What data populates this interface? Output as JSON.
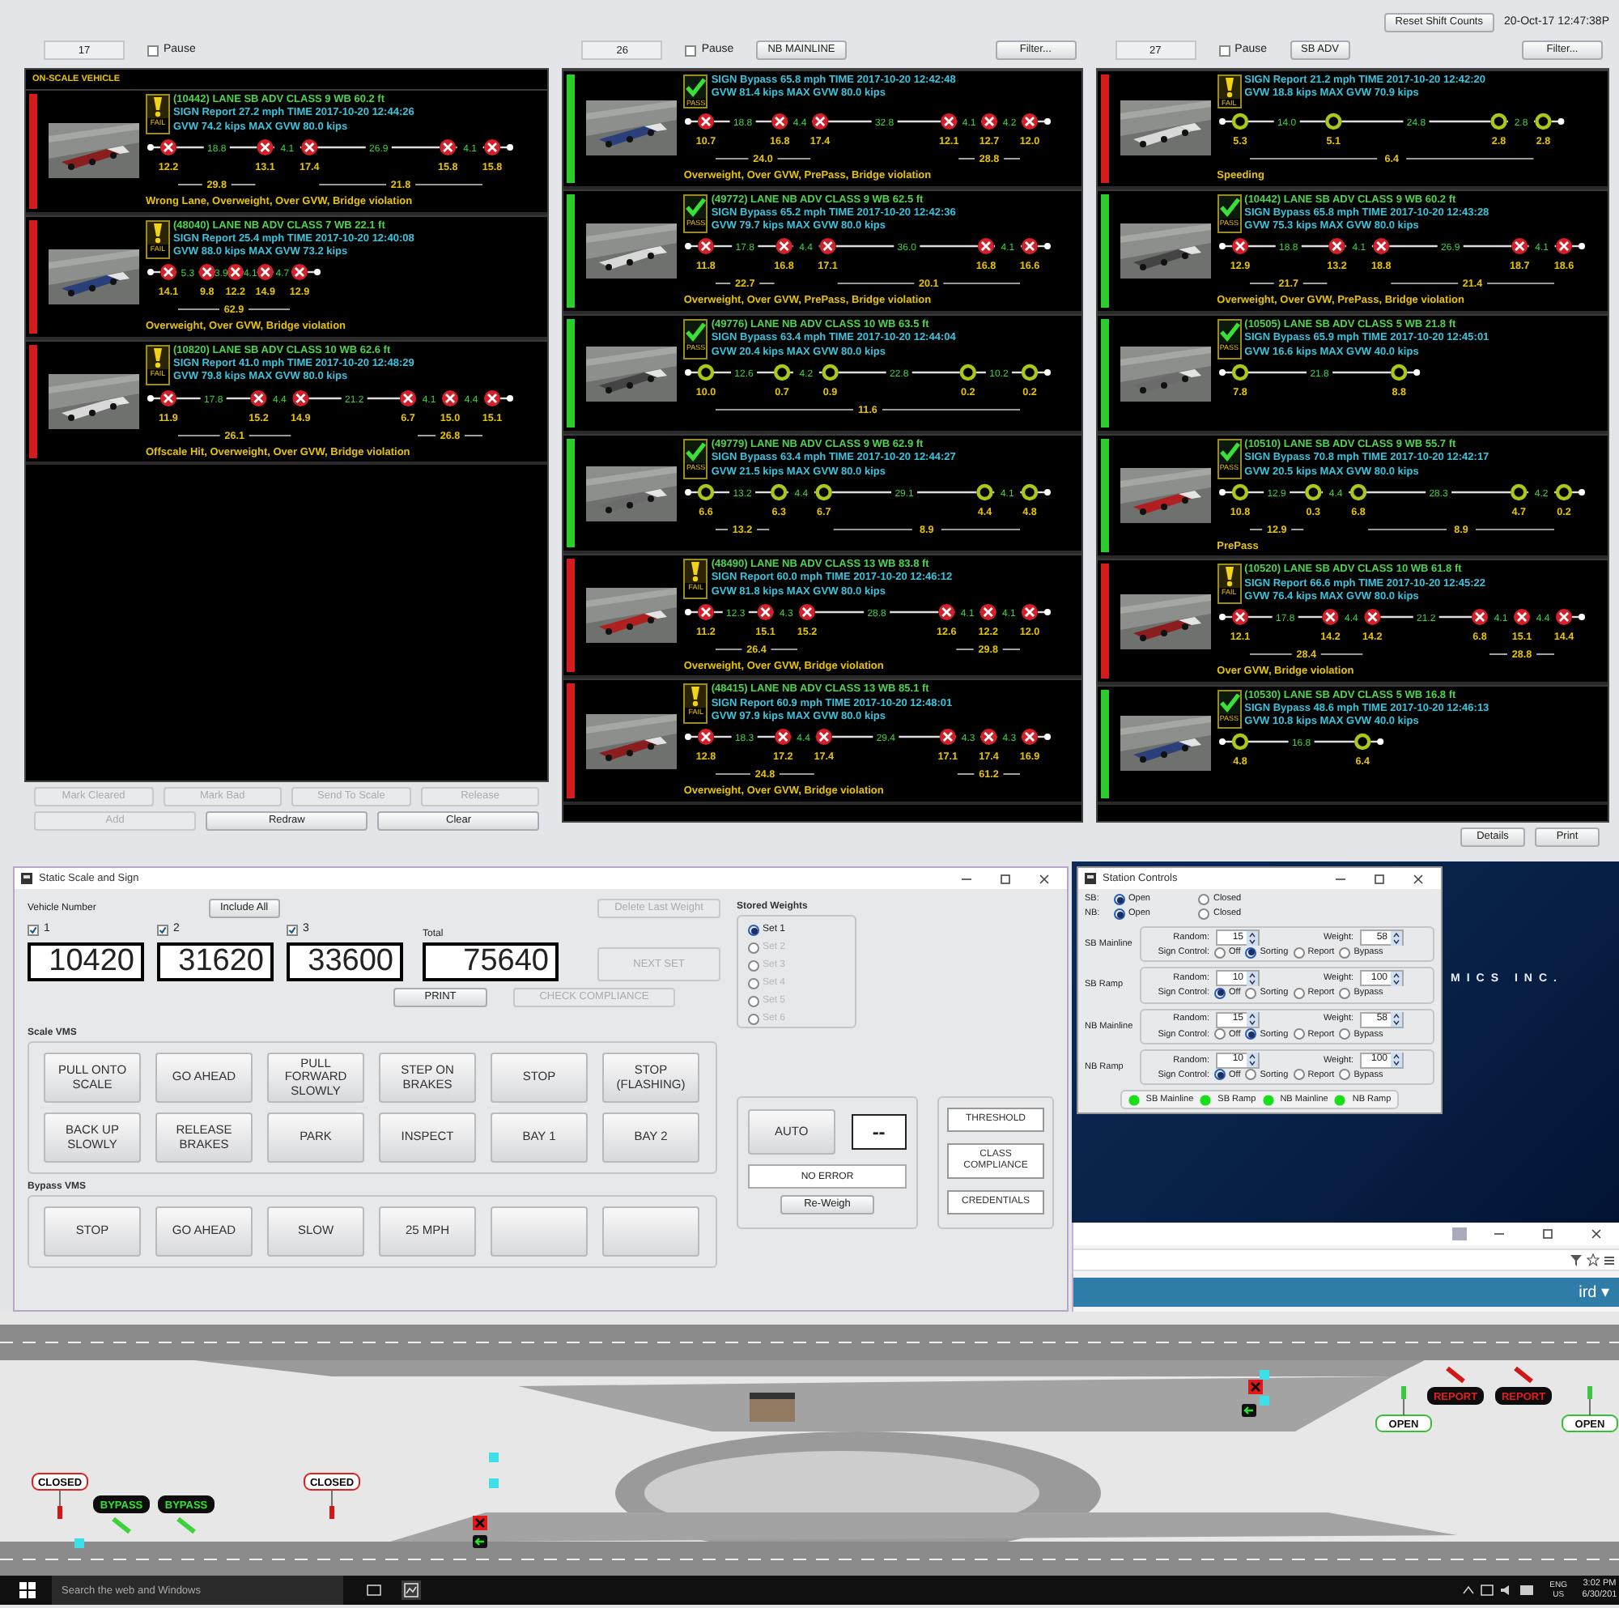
{
  "top_bar": {
    "reset_button": "Reset Shift Counts",
    "timestamp": "20-Oct-17 12:47:38P"
  },
  "panels": [
    {
      "count": "17",
      "pause": {
        "label": "Pause",
        "checked": false
      },
      "title": "ON-SCALE VEHICLE",
      "vehicles": [
        {
          "kind": "fail",
          "status_label": "FAIL",
          "lines": [
            "(10442) LANE SB ADV CLASS 9 WB 60.2 ft",
            "SIGN Report 27.2 mph TIME 2017-10-20 12:44:26",
            "GVW 74.2 kips MAX GVW 80.0 kips"
          ],
          "overweight_axles": true,
          "spacings": [
            "18.8",
            "4.1",
            "26.9",
            "4.1"
          ],
          "weights": [
            "12.2",
            "13.1",
            "17.4",
            "15.8",
            "15.8"
          ],
          "spans": [
            "29.8",
            "21.8"
          ],
          "violations": "Wrong Lane, Overweight, Over GVW, Bridge violation"
        },
        {
          "kind": "fail",
          "status_label": "FAIL",
          "lines": [
            "(48040) LANE NB ADV CLASS 7 WB 22.1 ft",
            "SIGN Report 25.4 mph TIME 2017-10-20 12:40:08",
            "GVW 88.0 kips MAX GVW 73.2 kips"
          ],
          "overweight_axles": true,
          "spacings": [
            "5.3",
            "3.9",
            "4.1",
            "4.7"
          ],
          "weights": [
            "14.1",
            "9.8",
            "12.2",
            "14.9",
            "12.9"
          ],
          "spans": [
            "62.9"
          ],
          "violations": "Overweight, Over GVW, Bridge violation"
        },
        {
          "kind": "fail",
          "status_label": "FAIL",
          "lines": [
            "(10820) LANE SB ADV CLASS 10 WB 62.6 ft",
            "SIGN Report 41.0 mph TIME 2017-10-20 12:48:29",
            "GVW 79.8 kips MAX GVW 80.0 kips"
          ],
          "overweight_axles": true,
          "spacings": [
            "17.8",
            "4.4",
            "21.2",
            "4.1",
            "4.4"
          ],
          "weights": [
            "11.9",
            "15.2",
            "14.9",
            "6.7",
            "15.0",
            "15.1"
          ],
          "spans": [
            "26.1",
            "26.8"
          ],
          "violations": "Offscale Hit, Overweight, Over GVW, Bridge violation"
        }
      ],
      "footer_rows": [
        [
          {
            "label": "Mark Cleared",
            "disabled": true
          },
          {
            "label": "Mark Bad",
            "disabled": true
          },
          {
            "label": "Send To Scale",
            "disabled": true
          },
          {
            "label": "Release",
            "disabled": true
          }
        ],
        [
          {
            "label": "Add",
            "disabled": true
          },
          {
            "label": "Redraw",
            "disabled": false
          },
          {
            "label": "Clear",
            "disabled": false
          }
        ]
      ]
    },
    {
      "count": "26",
      "pause": {
        "label": "Pause",
        "checked": false
      },
      "lane_filter": "NB MAINLINE",
      "filter_button": "Filter...",
      "vehicles": [
        {
          "kind": "pass",
          "status_label": "PASS",
          "lines": [
            "SIGN Bypass 65.8 mph TIME 2017-10-20 12:42:48",
            "GVW 81.4 kips MAX GVW 80.0 kips"
          ],
          "overweight_axles": true,
          "spacings": [
            "18.8",
            "4.4",
            "32.8",
            "4.1",
            "4.2"
          ],
          "weights": [
            "10.7",
            "16.8",
            "17.4",
            "12.1",
            "12.7",
            "12.0"
          ],
          "spans": [
            "24.0",
            "28.8"
          ],
          "violations": "Overweight, Over GVW, PrePass, Bridge violation"
        },
        {
          "kind": "pass",
          "status_label": "PASS",
          "lines": [
            "(49772) LANE NB ADV CLASS 9 WB 62.5 ft",
            "SIGN Bypass 65.2 mph TIME 2017-10-20 12:42:36",
            "GVW 79.7 kips MAX GVW 80.0 kips"
          ],
          "overweight_axles": true,
          "spacings": [
            "17.8",
            "4.4",
            "36.0",
            "4.1"
          ],
          "weights": [
            "11.8",
            "16.8",
            "17.1",
            "16.8",
            "16.6"
          ],
          "spans": [
            "22.7",
            "20.1"
          ],
          "violations": "Overweight, Over GVW, PrePass, Bridge violation"
        },
        {
          "kind": "pass",
          "status_label": "PASS",
          "lines": [
            "(49776) LANE NB ADV CLASS 10 WB 63.5 ft",
            "SIGN Bypass 63.4 mph TIME 2017-10-20 12:44:04",
            "GVW 20.4 kips MAX GVW 80.0 kips"
          ],
          "overweight_axles": false,
          "spacings": [
            "12.6",
            "4.2",
            "22.8",
            "10.2"
          ],
          "weights": [
            "10.0",
            "0.7",
            "0.9",
            "0.2",
            "0.2"
          ],
          "spans": [
            "11.6"
          ]
        },
        {
          "kind": "pass",
          "status_label": "PASS",
          "lines": [
            "(49779) LANE NB ADV CLASS 9 WB 62.9 ft",
            "SIGN Bypass 63.4 mph TIME 2017-10-20 12:44:27",
            "GVW 21.5 kips MAX GVW 80.0 kips"
          ],
          "overweight_axles": false,
          "spacings": [
            "13.2",
            "4.4",
            "29.1",
            "4.1"
          ],
          "weights": [
            "6.6",
            "6.3",
            "6.7",
            "4.4",
            "4.8"
          ],
          "spans": [
            "13.2",
            "8.9"
          ]
        },
        {
          "kind": "fail",
          "status_label": "FAIL",
          "lines": [
            "(48490) LANE NB ADV CLASS 13 WB 83.8 ft",
            "SIGN Report 60.0 mph TIME 2017-10-20 12:46:12",
            "GVW 81.8 kips MAX GVW 80.0 kips"
          ],
          "overweight_axles": true,
          "spacings": [
            "12.3",
            "4.3",
            "28.8",
            "4.1",
            "4.1"
          ],
          "weights": [
            "11.2",
            "15.1",
            "15.2",
            "12.6",
            "12.2",
            "12.0"
          ],
          "spans": [
            "26.4",
            "29.8"
          ],
          "violations": "Overweight, Over GVW, Bridge violation"
        },
        {
          "kind": "fail",
          "status_label": "FAIL",
          "lines": [
            "(48415) LANE NB ADV CLASS 13 WB 85.1 ft",
            "SIGN Report 60.9 mph TIME 2017-10-20 12:48:01",
            "GVW 97.9 kips MAX GVW 80.0 kips"
          ],
          "overweight_axles": true,
          "spacings": [
            "18.3",
            "4.4",
            "29.4",
            "4.3",
            "4.3"
          ],
          "weights": [
            "12.8",
            "17.2",
            "17.4",
            "17.1",
            "17.4",
            "16.9"
          ],
          "spans": [
            "24.8",
            "61.2"
          ],
          "violations": "Overweight, Over GVW, Bridge violation"
        }
      ]
    },
    {
      "count": "27",
      "pause": {
        "label": "Pause",
        "checked": false
      },
      "lane_filter": "SB ADV",
      "filter_button": "Filter...",
      "vehicles": [
        {
          "kind": "fail",
          "status_label": "FAIL",
          "lines": [
            "SIGN Report 21.2 mph TIME 2017-10-20 12:42:20",
            "GVW 18.8 kips MAX GVW 70.9 kips"
          ],
          "overweight_axles": false,
          "spacings": [
            "14.0",
            "24.8",
            "2.8"
          ],
          "weights": [
            "5.3",
            "5.1",
            "2.8",
            "2.8"
          ],
          "spans": [
            "6.4"
          ],
          "violations": "Speeding"
        },
        {
          "kind": "pass",
          "status_label": "PASS",
          "lines": [
            "(10442) LANE SB ADV CLASS 9 WB 60.2 ft",
            "SIGN Bypass 65.8 mph TIME 2017-10-20 12:43:28",
            "GVW 75.3 kips MAX GVW 80.0 kips"
          ],
          "overweight_axles": true,
          "spacings": [
            "18.8",
            "4.1",
            "26.9",
            "4.1"
          ],
          "weights": [
            "12.9",
            "13.2",
            "18.8",
            "18.7",
            "18.6"
          ],
          "spans": [
            "21.7",
            "21.4"
          ],
          "violations": "Overweight, Over GVW, PrePass, Bridge violation"
        },
        {
          "kind": "pass",
          "status_label": "PASS",
          "lines": [
            "(10505) LANE SB ADV CLASS 5 WB 21.8 ft",
            "SIGN Bypass 65.9 mph TIME 2017-10-20 12:45:01",
            "GVW 16.6 kips MAX GVW 40.0 kips"
          ],
          "overweight_axles": false,
          "spacings": [
            "21.8"
          ],
          "weights": [
            "7.8",
            "8.8"
          ]
        },
        {
          "kind": "pass",
          "status_label": "PASS",
          "lines": [
            "(10510) LANE SB ADV CLASS 9 WB 55.7 ft",
            "SIGN Bypass 70.8 mph TIME 2017-10-20 12:42:17",
            "GVW 20.5 kips MAX GVW 80.0 kips"
          ],
          "overweight_axles": false,
          "spacings": [
            "12.9",
            "4.4",
            "28.3",
            "4.2"
          ],
          "weights": [
            "10.8",
            "0.3",
            "6.8",
            "4.7",
            "0.2"
          ],
          "spans": [
            "12.9",
            "8.9"
          ],
          "violations": "PrePass"
        },
        {
          "kind": "fail",
          "status_label": "FAIL",
          "lines": [
            "(10520) LANE SB ADV CLASS 10 WB 61.8 ft",
            "SIGN Report 66.6 mph TIME 2017-10-20 12:45:22",
            "GVW 76.4 kips MAX GVW 80.0 kips"
          ],
          "overweight_axles": true,
          "spacings": [
            "17.8",
            "4.4",
            "21.2",
            "4.1",
            "4.4"
          ],
          "weights": [
            "12.1",
            "14.2",
            "14.2",
            "6.8",
            "15.1",
            "14.4"
          ],
          "spans": [
            "28.4",
            "28.8"
          ],
          "violations": "Over GVW, Bridge violation"
        },
        {
          "kind": "pass",
          "status_label": "PASS",
          "lines": [
            "(10530) LANE SB ADV CLASS 5 WB 16.8 ft",
            "SIGN Bypass 48.6 mph TIME 2017-10-20 12:46:13",
            "GVW 10.8 kips MAX GVW 40.0 kips"
          ],
          "overweight_axles": false,
          "spacings": [
            "16.8"
          ],
          "weights": [
            "4.8",
            "6.4"
          ]
        }
      ],
      "footer_rows": [
        [
          {
            "label": "Details",
            "disabled": false
          },
          {
            "label": "Print",
            "disabled": false
          }
        ]
      ]
    }
  ],
  "scale_window": {
    "title": "Static Scale and Sign",
    "vehicle_label": "Vehicle Number",
    "include_all": "Include All",
    "weights": [
      {
        "label": "1",
        "checked": true,
        "value": "10420"
      },
      {
        "label": "2",
        "checked": true,
        "value": "31620"
      },
      {
        "label": "3",
        "checked": true,
        "value": "33600"
      }
    ],
    "total_label": "Total",
    "total": "75640",
    "delete_last": {
      "label": "Delete Last Weight",
      "disabled": true
    },
    "next_set": {
      "label": "NEXT SET",
      "disabled": true
    },
    "print": {
      "label": "PRINT",
      "disabled": false
    },
    "check_compliance": {
      "label": "CHECK COMPLIANCE",
      "disabled": true
    },
    "stored_weights": {
      "title": "Stored Weights",
      "sets": [
        {
          "label": "Set 1",
          "selected": true,
          "disabled": false
        },
        {
          "label": "Set 2",
          "selected": false,
          "disabled": true
        },
        {
          "label": "Set 3",
          "selected": false,
          "disabled": true
        },
        {
          "label": "Set 4",
          "selected": false,
          "disabled": true
        },
        {
          "label": "Set 5",
          "selected": false,
          "disabled": true
        },
        {
          "label": "Set 6",
          "selected": false,
          "disabled": true
        }
      ]
    },
    "scale_vms": {
      "title": "Scale VMS",
      "buttons": [
        "PULL ONTO SCALE",
        "GO AHEAD",
        "PULL FORWARD SLOWLY",
        "STEP ON BRAKES",
        "STOP",
        "STOP (FLASHING)",
        "BACK UP SLOWLY",
        "RELEASE BRAKES",
        "PARK",
        "INSPECT",
        "BAY 1",
        "BAY 2"
      ]
    },
    "bypass_vms": {
      "title": "Bypass VMS",
      "buttons": [
        {
          "kind": "text",
          "label": "STOP"
        },
        {
          "kind": "text",
          "label": "GO AHEAD"
        },
        {
          "kind": "text",
          "label": "SLOW"
        },
        {
          "kind": "text",
          "label": "25 MPH"
        },
        {
          "kind": "blank"
        },
        {
          "kind": "blank"
        }
      ]
    },
    "auto_panel": {
      "button": "AUTO",
      "display": "--",
      "error": "NO ERROR",
      "reweigh": "Re-Weigh"
    },
    "side_buttons": [
      "THRESHOLD",
      "CLASS COMPLIANCE",
      "CREDENTIALS"
    ]
  },
  "station_window": {
    "title": "Station Controls",
    "directions": [
      {
        "label": "SB:",
        "options": [
          {
            "label": "Open",
            "selected": true
          },
          {
            "label": "Closed",
            "selected": false
          }
        ]
      },
      {
        "label": "NB:",
        "options": [
          {
            "label": "Open",
            "selected": true
          },
          {
            "label": "Closed",
            "selected": false
          }
        ]
      }
    ],
    "lanes": [
      {
        "name": "SB Mainline",
        "random_label": "Random:",
        "random": "15",
        "weight_label": "Weight:",
        "weight": "58",
        "sign_label": "Sign Control:",
        "options": [
          {
            "label": "Off",
            "selected": false
          },
          {
            "label": "Sorting",
            "selected": true
          },
          {
            "label": "Report",
            "selected": false
          },
          {
            "label": "Bypass",
            "selected": false
          }
        ]
      },
      {
        "name": "SB Ramp",
        "random_label": "Random:",
        "random": "10",
        "weight_label": "Weight:",
        "weight": "100",
        "sign_label": "Sign Control:",
        "options": [
          {
            "label": "Off",
            "selected": true
          },
          {
            "label": "Sorting",
            "selected": false
          },
          {
            "label": "Report",
            "selected": false
          },
          {
            "label": "Bypass",
            "selected": false
          }
        ]
      },
      {
        "name": "NB Mainline",
        "random_label": "Random:",
        "random": "15",
        "weight_label": "Weight:",
        "weight": "58",
        "sign_label": "Sign Control:",
        "options": [
          {
            "label": "Off",
            "selected": false
          },
          {
            "label": "Sorting",
            "selected": true
          },
          {
            "label": "Report",
            "selected": false
          },
          {
            "label": "Bypass",
            "selected": false
          }
        ]
      },
      {
        "name": "NB Ramp",
        "random_label": "Random:",
        "random": "10",
        "weight_label": "Weight:",
        "weight": "100",
        "sign_label": "Sign Control:",
        "options": [
          {
            "label": "Off",
            "selected": true
          },
          {
            "label": "Sorting",
            "selected": false
          },
          {
            "label": "Report",
            "selected": false
          },
          {
            "label": "Bypass",
            "selected": false
          }
        ]
      }
    ],
    "lights": [
      {
        "label": "SB Mainline",
        "on": true
      },
      {
        "label": "SB Ramp",
        "on": true
      },
      {
        "label": "NB Mainline",
        "on": true
      },
      {
        "label": "NB Ramp",
        "on": true
      }
    ]
  },
  "desktop": {
    "brand": "MICS INC."
  },
  "browser": {
    "user_menu": "ird ▾"
  },
  "map": {
    "signs": [
      {
        "kind": "closed",
        "label": "CLOSED"
      },
      {
        "kind": "bypass",
        "label": "BYPASS"
      },
      {
        "kind": "bypass",
        "label": "BYPASS"
      },
      {
        "kind": "closed",
        "label": "CLOSED"
      },
      {
        "kind": "report",
        "label": "REPORT"
      },
      {
        "kind": "report",
        "label": "REPORT"
      },
      {
        "kind": "open",
        "label": "OPEN"
      },
      {
        "kind": "open",
        "label": "OPEN"
      }
    ]
  },
  "taskbar": {
    "search": "Search the web and Windows",
    "language": "ENG",
    "region": "US",
    "time": "3:02 PM",
    "date": "6/30/201"
  }
}
